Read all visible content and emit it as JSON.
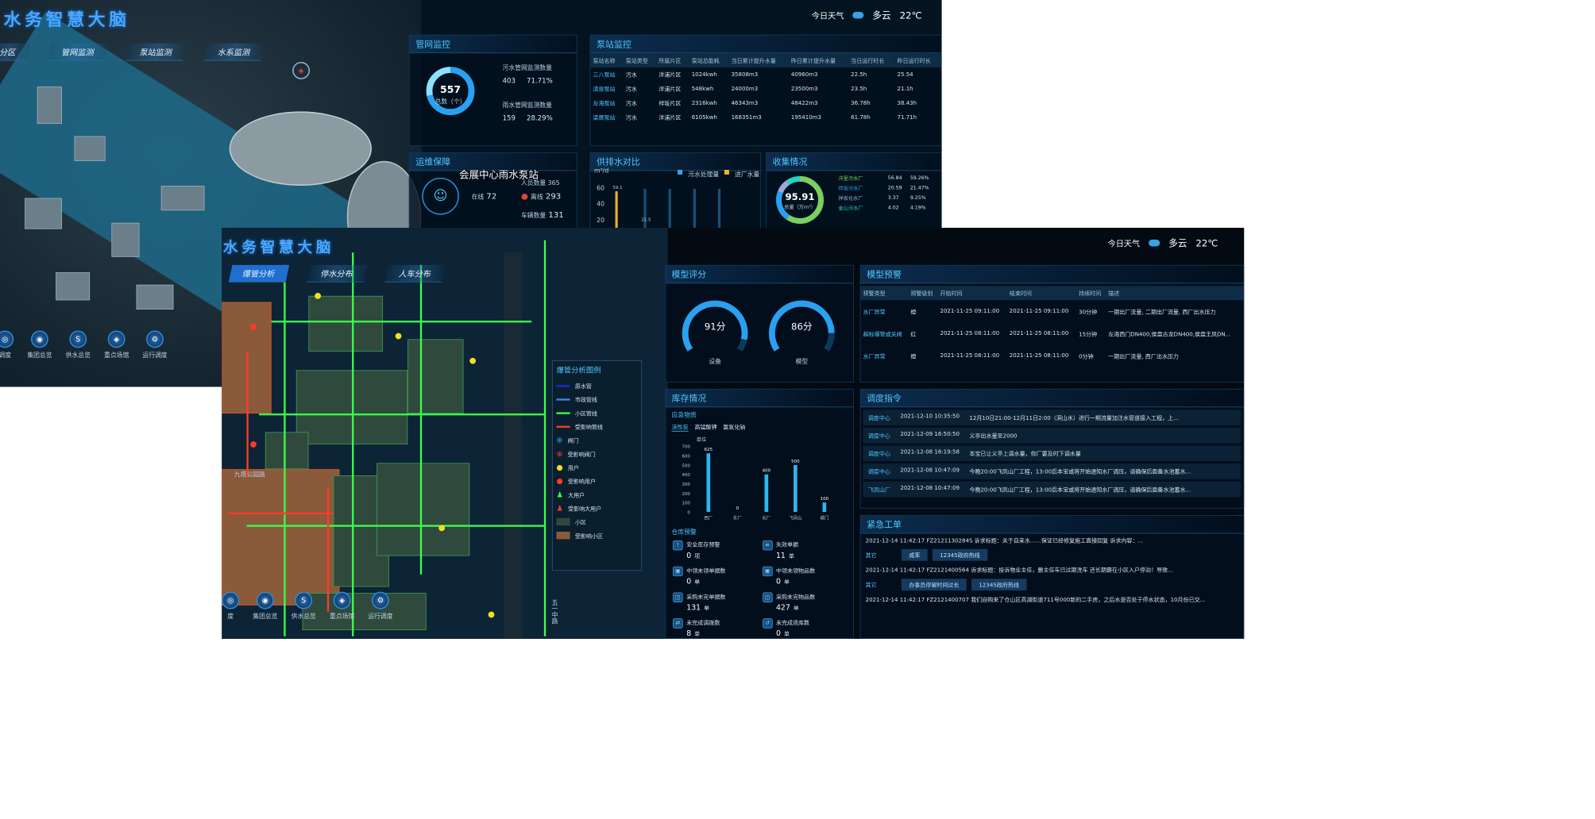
{
  "back": {
    "title": "水务智慧大脑",
    "weather": {
      "label": "今日天气",
      "condition": "多云",
      "temp": "22℃"
    },
    "tabs": [
      "分区",
      "管网监测",
      "泵站监测",
      "水系监测"
    ],
    "pipe_monitor": {
      "title": "管网监控",
      "total": "557",
      "total_label": "总数（个）",
      "rows": [
        {
          "name": "污水管网监测数量",
          "count": "403",
          "pct": "71.71%"
        },
        {
          "name": "雨水管网监测数量",
          "count": "159",
          "pct": "28.29%"
        }
      ]
    },
    "pump_monitor": {
      "title": "泵站监控",
      "headers": [
        "泵站名称",
        "泵站类型",
        "所属片区",
        "泵站总能耗",
        "当日累计提升水量",
        "昨日累计提升水量",
        "当日运行时长",
        "昨日运行时长"
      ],
      "rows": [
        [
          "三八泵站",
          "污水",
          "洋浦片区",
          "1024kwh",
          "35808m3",
          "40960m3",
          "22.5h",
          "25.54"
        ],
        [
          "滨泉泵站",
          "污水",
          "洋浦片区",
          "548kwh",
          "24000m3",
          "23500m3",
          "23.5h",
          "21.1h"
        ],
        [
          "左海泵站",
          "污水",
          "祥坂片区",
          "2316kwh",
          "46343m3",
          "48422m3",
          "36.78h",
          "38.43h"
        ],
        [
          "梁厝泵站",
          "污水",
          "洋浦片区",
          "6105kwh",
          "168351m3",
          "195410m3",
          "61.78h",
          "71.71h"
        ]
      ]
    },
    "ops": {
      "title": "运维保障",
      "overlay_label": "会展中心雨水泵站",
      "personnel_label": "人员数量",
      "personnel": "365",
      "online_label": "在线",
      "online": "72",
      "offline_label": "离线",
      "offline": "293",
      "car_label": "车辆数量",
      "car": "131"
    },
    "supply": {
      "title": "供排水对比",
      "unit": "m³/d",
      "legend": [
        "污水处理量",
        "进厂水量"
      ],
      "yticks": [
        "60",
        "40",
        "20"
      ],
      "labels": [
        "59.1",
        "21.5"
      ]
    },
    "collection": {
      "title": "收集情况",
      "total": "95.91",
      "total_label": "总量（万m³）",
      "rows": [
        {
          "name": "洋里污水厂",
          "v": "56.84",
          "pct": "59.26%"
        },
        {
          "name": "祥坂污水厂",
          "v": "20.59",
          "pct": "21.47%"
        },
        {
          "name": "祥坂化水厂",
          "v": "3.37",
          "pct": "9.25%"
        },
        {
          "name": "金山污水厂",
          "v": "4.02",
          "pct": "4.19%"
        }
      ]
    },
    "bottom_nav": [
      "调度",
      "集团总览",
      "供水总览",
      "重点场馆",
      "运行调度"
    ]
  },
  "front": {
    "title": "水务智慧大脑",
    "weather": {
      "label": "今日天气",
      "condition": "多云",
      "temp": "22℃"
    },
    "tabs": [
      "爆管分析",
      "停水分布",
      "人车分布"
    ],
    "legend": {
      "title": "爆管分析图例",
      "items": [
        "原水管",
        "市政管线",
        "小区管线",
        "受影响管线",
        "阀门",
        "受影响阀门",
        "用户",
        "受影响用户",
        "大用户",
        "受影响大用户",
        "小区",
        "受影响小区"
      ]
    },
    "map_label": "九塔公园路",
    "road_label": "五一中路",
    "bottom_nav": [
      "度",
      "集团总览",
      "供水总览",
      "重点场馆",
      "运行调度"
    ],
    "model_score": {
      "title": "模型评分",
      "gauges": [
        {
          "value": "91分",
          "label": "设备",
          "score": 91
        },
        {
          "value": "86分",
          "label": "模型",
          "score": 86
        }
      ]
    },
    "model_warning": {
      "title": "模型预警",
      "headers": [
        "预警类型",
        "预警级别",
        "开始时间",
        "结束时间",
        "持续时间",
        "描述"
      ],
      "rows": [
        [
          "水厂异常",
          "橙",
          "2021-11-25 09:11:00",
          "2021-11-25 09:11:00",
          "30分钟",
          "一期出厂流量, 二期出厂流量, 西厂出水压力"
        ],
        [
          "超标爆管或关阀",
          "红",
          "2021-11-25 08:11:00",
          "2021-11-25 08:11:00",
          "15分钟",
          "左海西门DN400,侯盘古龙DN400,侯盘王凤DN..."
        ],
        [
          "水厂异常",
          "橙",
          "2021-11-25 08:11:00",
          "2021-11-25 08:11:00",
          "0分钟",
          "一期出厂流量, 西厂出水压力"
        ]
      ]
    },
    "inventory": {
      "title": "库存情况",
      "sub": "应急物资",
      "tabs": [
        "活性炭",
        "高锰酸钾",
        "氯氧化钠"
      ],
      "unit": "单位",
      "warehouse_label": "仓库预警",
      "stats": [
        {
          "label": "安全库存预警",
          "value": "0",
          "unit": "项"
        },
        {
          "label": "失效单据",
          "value": "11",
          "unit": "单"
        },
        {
          "label": "中领未领单据数",
          "value": "0",
          "unit": "单"
        },
        {
          "label": "中领未领物品数",
          "value": "0",
          "unit": "单"
        },
        {
          "label": "采购未完单据数",
          "value": "131",
          "unit": "单"
        },
        {
          "label": "采购未完物品数",
          "value": "427",
          "unit": "单"
        },
        {
          "label": "未完成调拨数",
          "value": "8",
          "unit": "单"
        },
        {
          "label": "未完成退库数",
          "value": "0",
          "unit": "单"
        }
      ]
    },
    "dispatch": {
      "title": "调度指令",
      "rows": [
        {
          "src": "调度中心",
          "time": "2021-12-10 10:35:50",
          "text": "12月10日21:00-12月11日2:00（洞山水）进行一期流量加注水管道接入工程，上..."
        },
        {
          "src": "调度中心",
          "time": "2021-12-09 16:50:50",
          "text": "义亭出水量至2000"
        },
        {
          "src": "调度中心",
          "time": "2021-12-08 16:19:58",
          "text": "本宝已让义亭上调水量，你厂要及时下调水量"
        },
        {
          "src": "调度中心",
          "time": "2021-12-08 10:47:09",
          "text": "今晚20:00飞凤山厂工程，13:00后本宝或将开始通知水厂调压，请确保后面备水池蓄水..."
        },
        {
          "src": "飞凤山厂",
          "time": "2021-12-08 10:47:09",
          "text": "今晚20:00飞凤山厂工程，13:00后本宝或将开始通知水厂调压，请确保后面备水池蓄水..."
        }
      ]
    },
    "urgent": {
      "title": "紧急工单",
      "items": [
        {
          "text": "2021-12-14 11:42:17  FZ2121130284S 诉求标题：关于自来水……保证已经修复施工直接回复 诉求内容：..."
        },
        {
          "type": "其它",
          "pills": [
            "咸率",
            "12345政府热线"
          ]
        },
        {
          "text": "2021-12-14 11:42:17  FZ2121400564 诉求标题：投诉物业主任，删主任车已过期洗车 还长期霸在小区入户停泊！导致..."
        },
        {
          "type": "其它",
          "pills": [
            "办事员停留时间过长",
            "12345政府热线"
          ]
        },
        {
          "text": "2021-12-14 11:42:17  FZ2121400707 我们自购来了仓山区高湖街道711号000新的二手房，之后水是否处于停水状态，10月份已交..."
        }
      ]
    }
  },
  "chart_data": [
    {
      "type": "bar",
      "title": "",
      "categories": [
        "西厂",
        "东厂",
        "长厂",
        "飞凤山",
        "城门"
      ],
      "values": [
        625,
        0,
        400,
        500,
        100
      ],
      "ylabel": "单位",
      "ylim": [
        0,
        700
      ],
      "yticks": [
        0,
        100,
        200,
        300,
        400,
        500,
        600,
        700
      ]
    }
  ],
  "colors": {
    "accent": "#4fc8ff",
    "pipe_green": "#39ff4a",
    "pipe_red": "#ff3a2a",
    "block_brown": "#8a5a3a",
    "title_blue": "#4aa8ff"
  }
}
